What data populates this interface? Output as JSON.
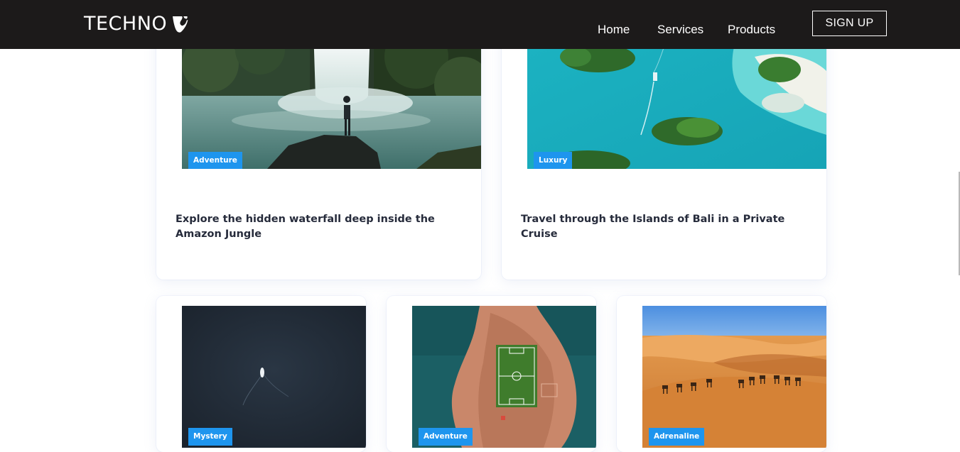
{
  "header": {
    "brand": "TECHNO",
    "logo_icon": "typo3-logo-icon",
    "nav": [
      "Home",
      "Services",
      "Products"
    ],
    "signup_label": "SIGN UP",
    "background_color": "#1c1a1a"
  },
  "accent_color": "#1e95ee",
  "cards": [
    {
      "tag": "Adventure",
      "title": "Explore the hidden waterfall deep inside the Amazon Jungle",
      "image": "waterfall-photo"
    },
    {
      "tag": "Luxury",
      "title": "Travel through the Islands of Bali in a Private Cruise",
      "image": "islands-aerial-photo"
    },
    {
      "tag": "Mystery",
      "image": "ocean-boat-photo"
    },
    {
      "tag": "Adventure",
      "image": "island-football-field-photo"
    },
    {
      "tag": "Adrenaline",
      "image": "desert-camels-photo"
    }
  ]
}
